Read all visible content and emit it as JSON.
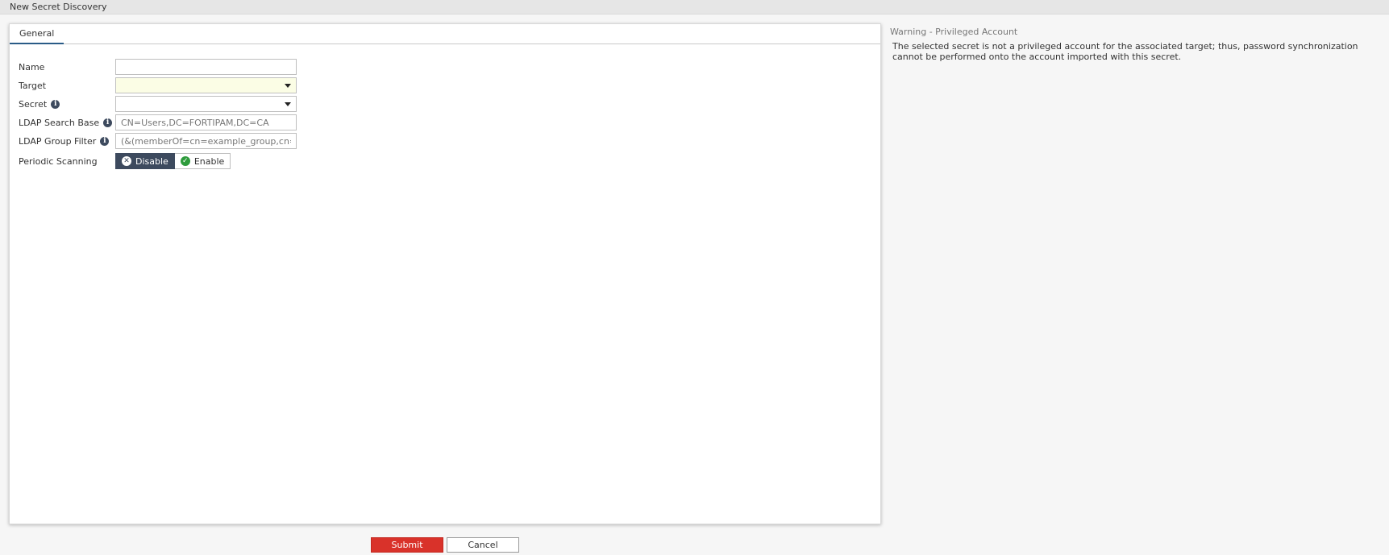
{
  "window": {
    "title": "New Secret Discovery"
  },
  "tabs": [
    {
      "label": "General"
    }
  ],
  "form": {
    "name": {
      "label": "Name",
      "value": ""
    },
    "target": {
      "label": "Target",
      "value": ""
    },
    "secret": {
      "label": "Secret",
      "value": ""
    },
    "ldap_search_base": {
      "label": "LDAP Search Base",
      "placeholder": "CN=Users,DC=FORTIPAM,DC=CA"
    },
    "ldap_group_filter": {
      "label": "LDAP Group Filter",
      "placeholder": "(&(memberOf=cn=example_group,cn=users"
    },
    "periodic_scanning": {
      "label": "Periodic Scanning",
      "disable_label": "Disable",
      "enable_label": "Enable",
      "selected": "Disable"
    }
  },
  "warning": {
    "title": "Warning - Privileged Account",
    "text": "The selected secret is not a privileged account for the associated target; thus, password synchronization cannot be performed onto the account imported with this secret."
  },
  "actions": {
    "submit_label": "Submit",
    "cancel_label": "Cancel"
  },
  "icons": {
    "info": "info-icon",
    "disable": "x-circle-icon",
    "enable": "check-circle-icon",
    "dropdown": "chevron-down-icon"
  },
  "colors": {
    "accent": "#3d4a5e",
    "submit": "#d9322a",
    "enable_green": "#2e9b3c",
    "required_bg": "#fbfde5"
  }
}
